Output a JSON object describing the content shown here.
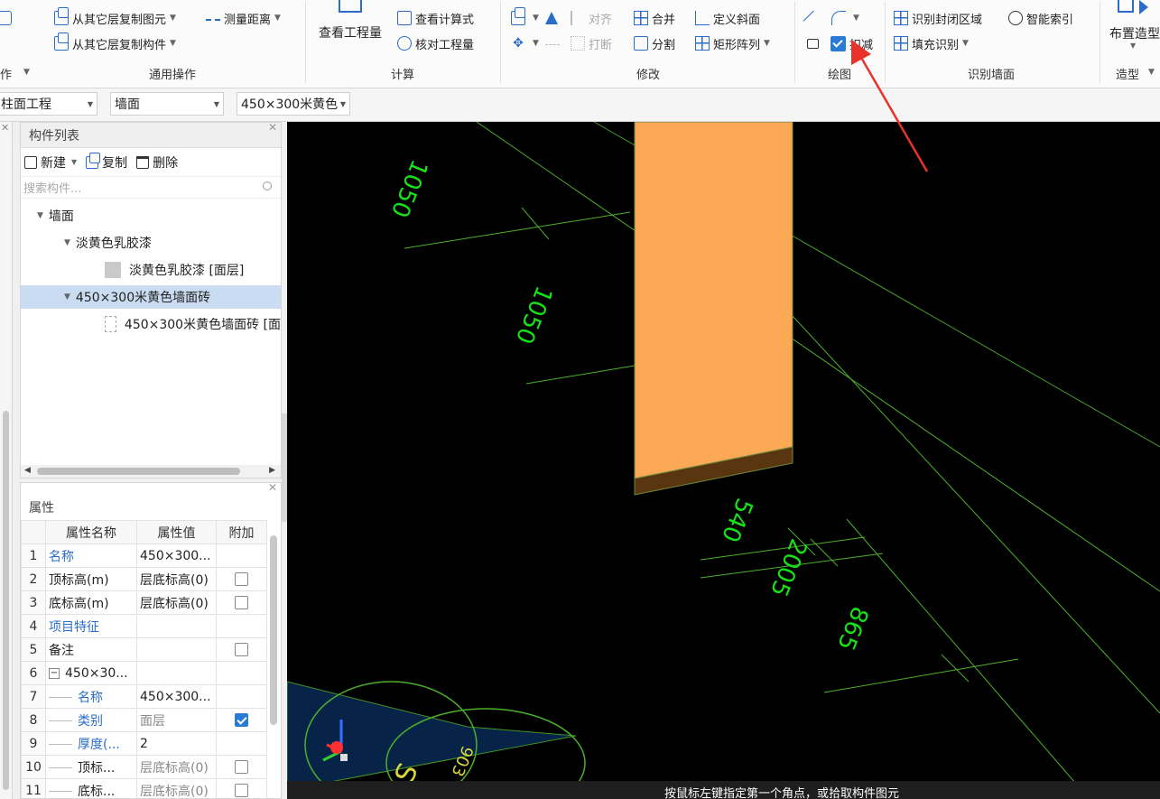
{
  "ribbon": {
    "common_ops": {
      "copy_from_other_floor": "从其它层复制图元",
      "measure_distance": "测量距离",
      "copy_component": "从其它层复制构件",
      "group_label": "通用操作",
      "left_cut_label": "作"
    },
    "calc": {
      "view_quantity": "查看工程量",
      "view_formula": "查看计算式",
      "check_quantity": "核对工程量",
      "group_label": "计算"
    },
    "modify": {
      "align": "对齐",
      "merge": "合并",
      "define_slope": "定义斜面",
      "break": "打断",
      "split": "分割",
      "rect_array": "矩形阵列",
      "group_label": "修改"
    },
    "draw": {
      "deduct": "扣减",
      "group_label": "绘图"
    },
    "identify_wall": {
      "identify_closed_area": "识别封闭区域",
      "smart_index": "智能索引",
      "fill_identify": "填充识别",
      "group_label": "识别墙面"
    },
    "shape": {
      "place_shape": "布置造型",
      "group_label": "造型"
    }
  },
  "toolbar2": {
    "combo1": "柱面工程",
    "combo2": "墙面",
    "combo3": "450×300米黄色"
  },
  "component_list": {
    "title": "构件列表",
    "new": "新建",
    "copy": "复制",
    "delete": "删除",
    "search_placeholder": "搜索构件...",
    "tree": {
      "root": "墙面",
      "child1": "淡黄色乳胶漆",
      "child1_layer": "淡黄色乳胶漆 [面层]",
      "child2": "450×300米黄色墙面砖",
      "child2_layer": "450×300米黄色墙面砖 [面"
    }
  },
  "properties": {
    "title": "属性",
    "headers": {
      "name": "属性名称",
      "value": "属性值",
      "extra": "附加"
    },
    "rows": [
      {
        "num": "1",
        "name": "名称",
        "value": "450×300..."
      },
      {
        "num": "2",
        "name": "顶标高(m)",
        "value": "层底标高(0)"
      },
      {
        "num": "3",
        "name": "底标高(m)",
        "value": "层底标高(0)"
      },
      {
        "num": "4",
        "name": "项目特征",
        "value": ""
      },
      {
        "num": "5",
        "name": "备注",
        "value": ""
      },
      {
        "num": "6",
        "name": "450×30...",
        "value": ""
      },
      {
        "num": "7",
        "name": "名称",
        "value": "450×300..."
      },
      {
        "num": "8",
        "name": "类别",
        "value": "面层"
      },
      {
        "num": "9",
        "name": "厚度(...",
        "value": "2"
      },
      {
        "num": "10",
        "name": "顶标...",
        "value": "层底标高(0)"
      },
      {
        "num": "11",
        "name": "底标...",
        "value": "层底标高(0)"
      }
    ]
  },
  "canvas": {
    "dims": {
      "d1": "1050",
      "d2": "1050",
      "d3": "540",
      "d4": "2005",
      "d5": "865",
      "d6": "S",
      "d7": "903"
    },
    "status": "按鼠标左键指定第一个角点，或拾取构件图元"
  },
  "colors": {
    "accent": "#2a6cc7",
    "wall": "#fba955",
    "wall_base": "#5a3610",
    "dim_line": "#4caf2a",
    "dim_text": "#18e018",
    "annot": "#d8d83c"
  }
}
